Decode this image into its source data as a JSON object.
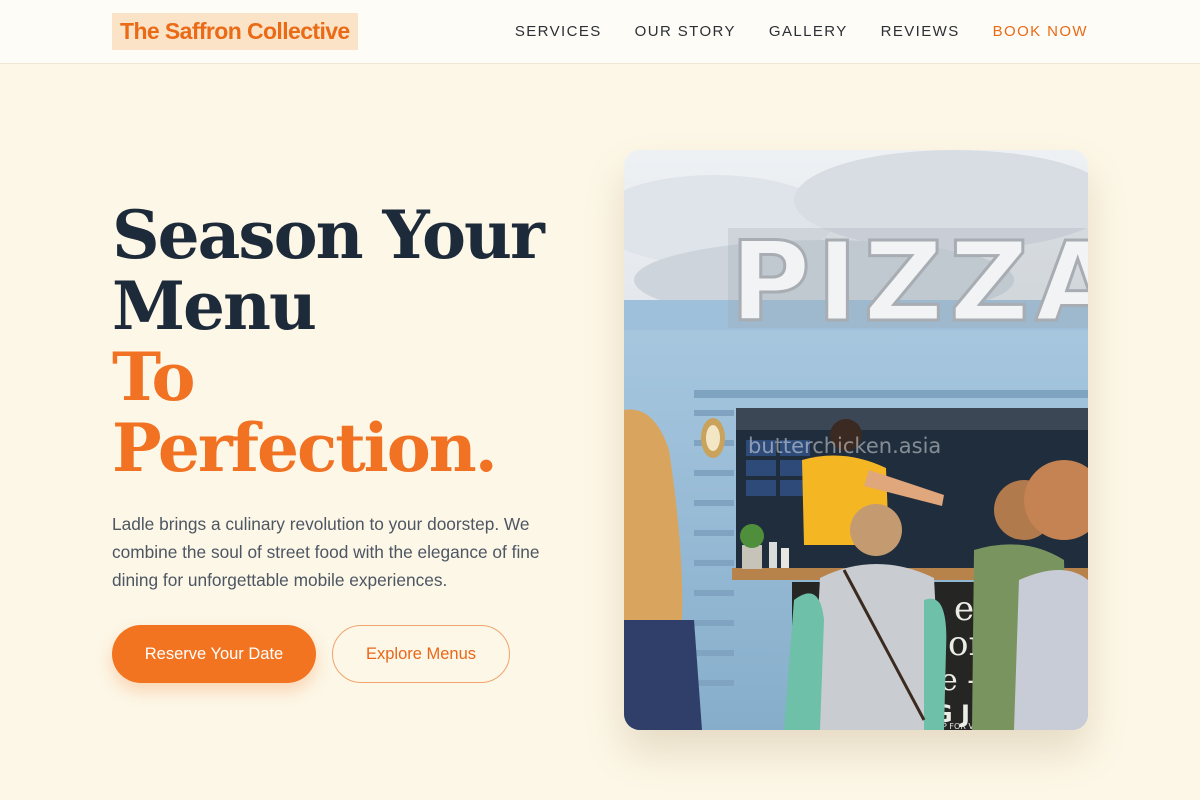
{
  "brand": {
    "name": "The Saffron Collective"
  },
  "nav": {
    "items": [
      {
        "label": "SERVICES"
      },
      {
        "label": "OUR STORY"
      },
      {
        "label": "GALLERY"
      },
      {
        "label": "REVIEWS"
      }
    ],
    "cta": "BOOK NOW"
  },
  "hero": {
    "headline_line1": "Season Your",
    "headline_line2": "Menu",
    "headline_accent1": "To",
    "headline_accent2": "Perfection.",
    "description": "Ladle brings a culinary revolution to your doorstep. We combine the soul of street food with the elegance of fine dining for unforgettable mobile experiences.",
    "primary_button": "Reserve Your Date",
    "secondary_button": "Explore Menus"
  },
  "photo": {
    "sign_text": "PIZZA",
    "watermark": "butterchicken.asia",
    "board_lines": [
      "erit",
      "onl",
      "e -",
      "IG J"
    ],
    "board_small": "SWAP FOR VE"
  },
  "colors": {
    "accent": "#f37420",
    "headline": "#1d2a39",
    "background": "#fdf7e7",
    "logo_bg": "#fbe3c7",
    "truck_blue": "#93b9d6"
  }
}
